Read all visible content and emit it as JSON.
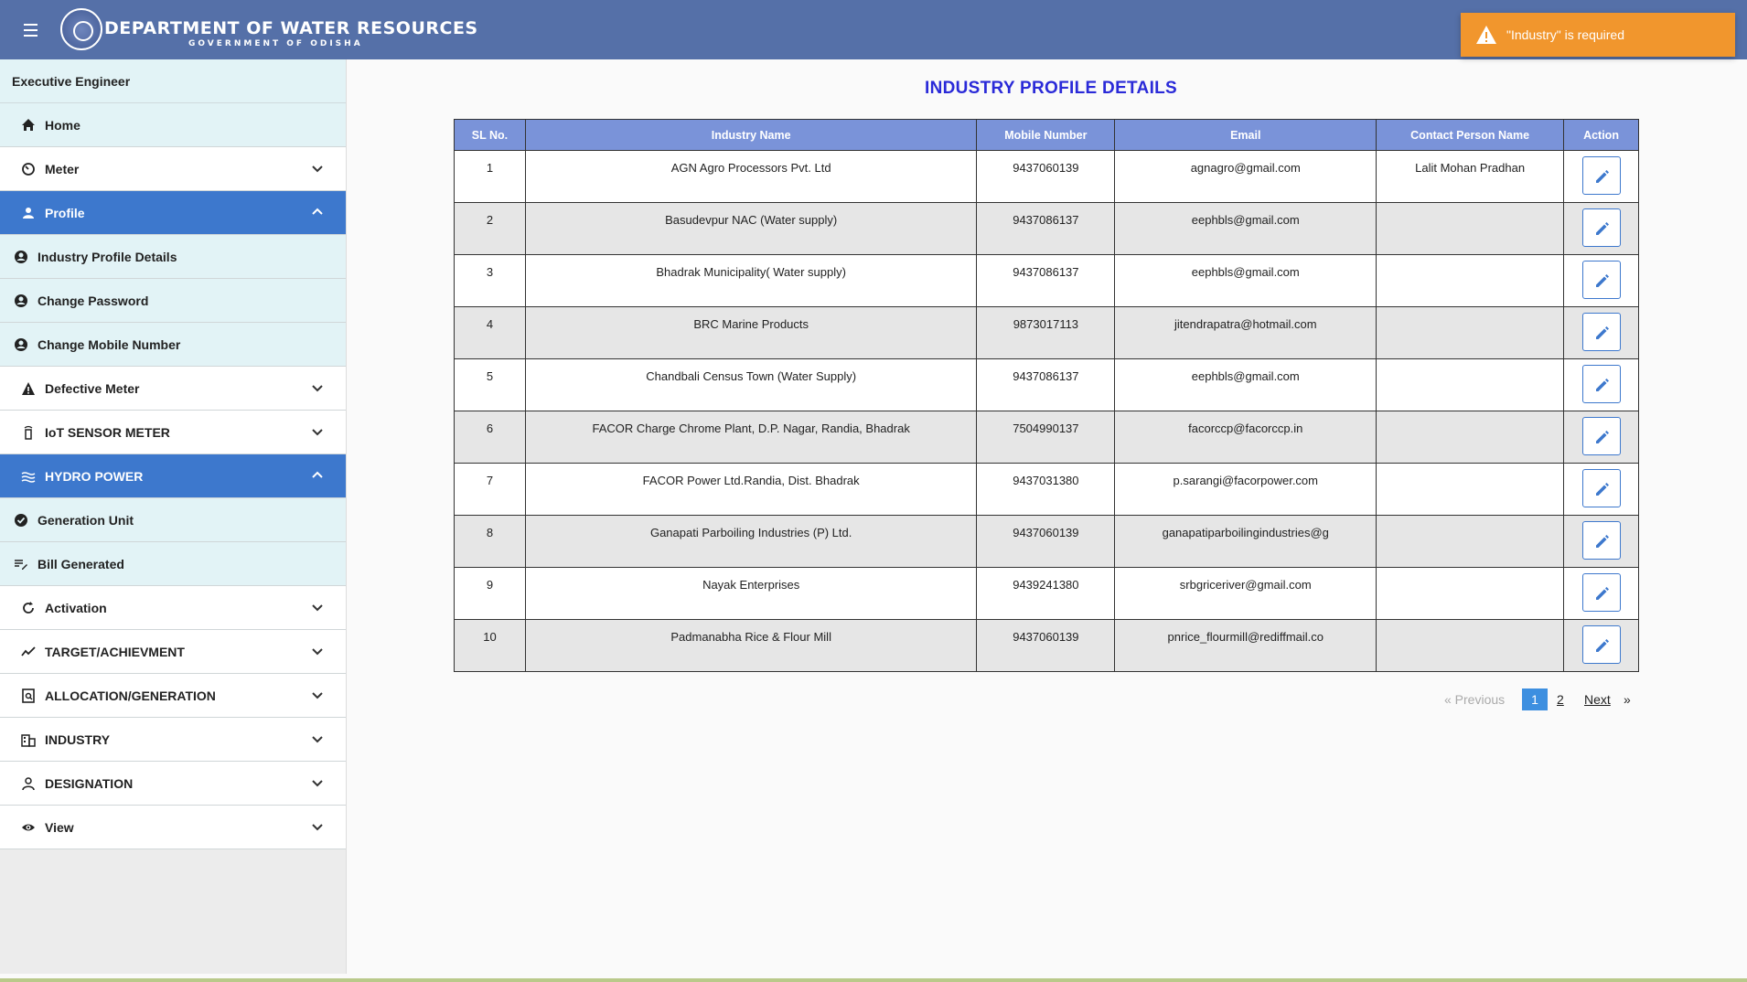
{
  "header": {
    "title": "DEPARTMENT OF WATER RESOURCES",
    "subtitle": "GOVERNMENT OF ODISHA"
  },
  "toast": {
    "message": "\"Industry\" is required",
    "color": "#f1962d"
  },
  "sidebar": {
    "user_role": "Executive Engineer",
    "items": [
      {
        "label": "Home",
        "icon": "home-icon"
      },
      {
        "label": "Meter",
        "icon": "gauge-icon"
      },
      {
        "label": "Profile",
        "icon": "person-icon",
        "expanded": true
      },
      {
        "label": "Industry Profile Details",
        "icon": "account-circle-icon"
      },
      {
        "label": "Change Password",
        "icon": "account-circle-icon"
      },
      {
        "label": "Change Mobile Number",
        "icon": "account-circle-icon"
      },
      {
        "label": "Defective Meter",
        "icon": "warning-icon"
      },
      {
        "label": "IoT SENSOR METER",
        "icon": "sensor-icon"
      },
      {
        "label": "HYDRO POWER",
        "icon": "waves-icon",
        "expanded": true
      },
      {
        "label": "Generation Unit",
        "icon": "check-circle-icon"
      },
      {
        "label": "Bill Generated",
        "icon": "edit-note-icon"
      },
      {
        "label": "Activation",
        "icon": "refresh-icon"
      },
      {
        "label": "TARGET/ACHIEVMENT",
        "icon": "trending-icon"
      },
      {
        "label": "ALLOCATION/GENERATION",
        "icon": "document-search-icon"
      },
      {
        "label": "INDUSTRY",
        "icon": "building-icon"
      },
      {
        "label": "DESIGNATION",
        "icon": "person-outline-icon"
      },
      {
        "label": "View",
        "icon": "eye-icon"
      }
    ]
  },
  "main": {
    "title": "INDUSTRY PROFILE DETAILS",
    "columns": [
      "SL No.",
      "Industry Name",
      "Mobile Number",
      "Email",
      "Contact Person Name",
      "Action"
    ],
    "rows": [
      {
        "sl": "1",
        "name": "AGN Agro Processors Pvt. Ltd",
        "mobile": "9437060139",
        "email": "agnagro@gmail.com",
        "contact": "Lalit Mohan Pradhan"
      },
      {
        "sl": "2",
        "name": "Basudevpur NAC (Water supply)",
        "mobile": "9437086137",
        "email": "eephbls@gmail.com",
        "contact": ""
      },
      {
        "sl": "3",
        "name": "Bhadrak Municipality( Water supply)",
        "mobile": "9437086137",
        "email": "eephbls@gmail.com",
        "contact": ""
      },
      {
        "sl": "4",
        "name": "BRC Marine Products",
        "mobile": "9873017113",
        "email": "jitendrapatra@hotmail.com",
        "contact": ""
      },
      {
        "sl": "5",
        "name": "Chandbali Census Town (Water Supply)",
        "mobile": "9437086137",
        "email": "eephbls@gmail.com",
        "contact": ""
      },
      {
        "sl": "6",
        "name": "FACOR Charge Chrome Plant, D.P. Nagar, Randia, Bhadrak",
        "mobile": "7504990137",
        "email": "facorccp@facorccp.in",
        "contact": ""
      },
      {
        "sl": "7",
        "name": "FACOR Power Ltd.Randia, Dist. Bhadrak",
        "mobile": "9437031380",
        "email": "p.sarangi@facorpower.com",
        "contact": ""
      },
      {
        "sl": "8",
        "name": "Ganapati Parboiling Industries (P) Ltd.",
        "mobile": "9437060139",
        "email": "ganapatiparboilingindustries@g",
        "contact": ""
      },
      {
        "sl": "9",
        "name": "Nayak Enterprises",
        "mobile": "9439241380",
        "email": "srbgriceriver@gmail.com",
        "contact": ""
      },
      {
        "sl": "10",
        "name": "Padmanabha Rice & Flour Mill",
        "mobile": "9437060139",
        "email": "pnrice_flourmill@rediffmail.co",
        "contact": ""
      }
    ]
  },
  "pager": {
    "prev_label": "« Previous",
    "page1": "1",
    "page2": "2",
    "next_label": "Next",
    "next_arrow": "»"
  }
}
